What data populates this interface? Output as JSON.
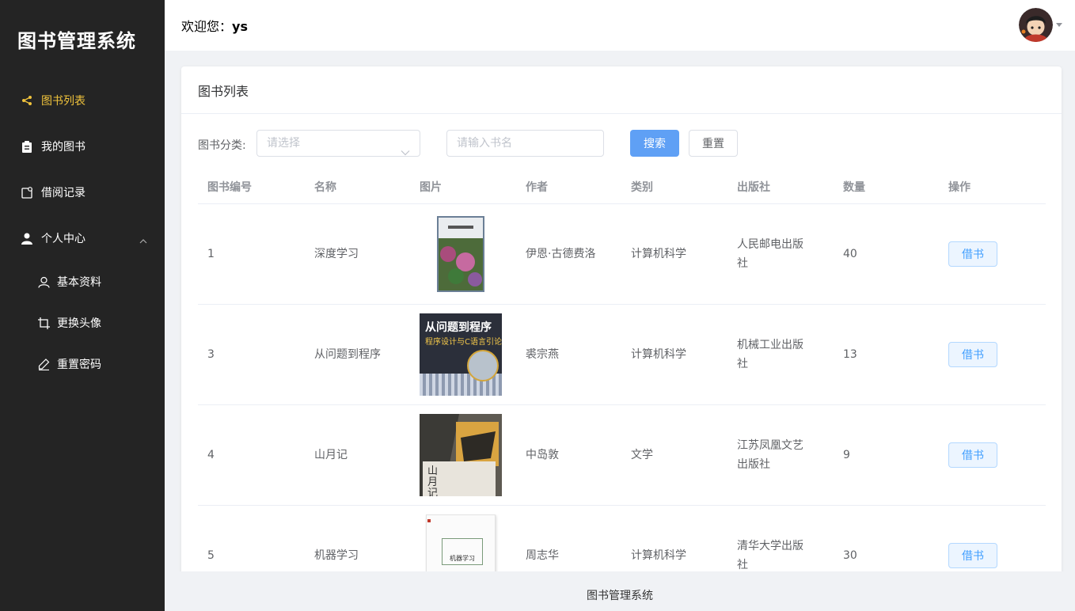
{
  "sidebar": {
    "title": "图书管理系统",
    "items": [
      {
        "label": "图书列表",
        "icon": "share-icon"
      },
      {
        "label": "我的图书",
        "icon": "clipboard-icon"
      },
      {
        "label": "借阅记录",
        "icon": "record-icon"
      },
      {
        "label": "个人中心",
        "icon": "user-icon"
      }
    ],
    "subitems": [
      {
        "label": "基本资料",
        "icon": "user-outline-icon"
      },
      {
        "label": "更换头像",
        "icon": "crop-icon"
      },
      {
        "label": "重置密码",
        "icon": "edit-icon"
      }
    ]
  },
  "header": {
    "welcome_prefix": "欢迎您：",
    "username": "ys"
  },
  "card": {
    "title": "图书列表"
  },
  "filters": {
    "category_label": "图书分类:",
    "category_placeholder": "请选择",
    "name_placeholder": "请输入书名",
    "search_label": "搜索",
    "reset_label": "重置"
  },
  "table": {
    "headers": [
      "图书编号",
      "名称",
      "图片",
      "作者",
      "类别",
      "出版社",
      "数量",
      "操作"
    ],
    "rows": [
      {
        "id": "1",
        "name": "深度学习",
        "author": "伊恩·古德费洛",
        "category": "计算机科学",
        "publisher": "人民邮电出版社",
        "count": "40",
        "action": "借书"
      },
      {
        "id": "3",
        "name": "从问题到程序",
        "author": "裘宗燕",
        "category": "计算机科学",
        "publisher": "机械工业出版社",
        "count": "13",
        "action": "借书",
        "cover_title": "从问题到程序",
        "cover_subtitle": "程序设计与C语言引论"
      },
      {
        "id": "4",
        "name": "山月记",
        "author": "中岛敦",
        "category": "文学",
        "publisher": "江苏凤凰文艺出版社",
        "count": "9",
        "action": "借书",
        "cover_title": "山月记"
      },
      {
        "id": "5",
        "name": "机器学习",
        "author": "周志华",
        "category": "计算机科学",
        "publisher": "清华大学出版社",
        "count": "30",
        "action": "借书",
        "cover_title": "机器学习"
      }
    ]
  },
  "footer": {
    "text": "图书管理系统"
  },
  "colors": {
    "sidebar_bg": "#242424",
    "active": "#f0c33c",
    "primary": "#5fa0f5"
  }
}
